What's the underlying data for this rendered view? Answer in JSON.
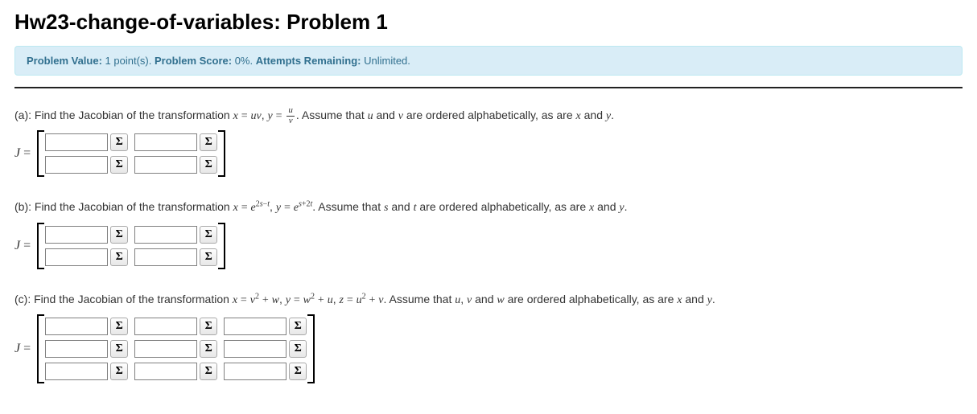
{
  "title": "Hw23-change-of-variables: Problem 1",
  "alert": {
    "value_label": "Problem Value:",
    "value_text": "1 point(s).",
    "score_label": "Problem Score:",
    "score_text": "0%.",
    "attempts_label": "Attempts Remaining:",
    "attempts_text": "Unlimited."
  },
  "sigma": "Σ",
  "jacobian_label": "J",
  "equals": "=",
  "parts": {
    "a": {
      "label": "(a):",
      "lead": "Find the Jacobian of the transformation",
      "expr_html": "<span class='mi'>x</span> <span class='eq'>=</span> <span class='mi'>uv</span>, <span class='mi'>y</span> <span class='eq'>=</span> <span class='frac'><span class='num mi'>u</span><span class='den mi'>v</span></span>.",
      "tail": "Assume that <span class='mi'>u</span> and <span class='mi'>v</span> are ordered alphabetically, as are <span class='mi'>x</span> and <span class='mi'>y</span>."
    },
    "b": {
      "label": "(b):",
      "lead": "Find the Jacobian of the transformation",
      "expr_html": "<span class='mi'>x</span> <span class='eq'>=</span> <span class='mi'>e</span><span class='sup'>2<span class='mi'>s</span>−<span class='mi'>t</span></span>, <span class='mi'>y</span> <span class='eq'>=</span> <span class='mi'>e</span><span class='sup'><span class='mi'>s</span>+2<span class='mi'>t</span></span>.",
      "tail": "Assume that <span class='mi'>s</span> and <span class='mi'>t</span> are ordered alphabetically, as are <span class='mi'>x</span> and <span class='mi'>y</span>."
    },
    "c": {
      "label": "(c):",
      "lead": "Find the Jacobian of the transformation",
      "expr_html": "<span class='mi'>x</span> <span class='eq'>=</span> <span class='mi'>v</span><span class='sup'>2</span> <span class='eq'>+</span> <span class='mi'>w</span>, <span class='mi'>y</span> <span class='eq'>=</span> <span class='mi'>w</span><span class='sup'>2</span> <span class='eq'>+</span> <span class='mi'>u</span>, <span class='mi'>z</span> <span class='eq'>=</span> <span class='mi'>u</span><span class='sup'>2</span> <span class='eq'>+</span> <span class='mi'>v</span>.",
      "tail": "Assume that <span class='mi'>u</span>, <span class='mi'>v</span> and <span class='mi'>w</span> are ordered alphabetically, as are <span class='mi'>x</span> and <span class='mi'>y</span>."
    }
  }
}
